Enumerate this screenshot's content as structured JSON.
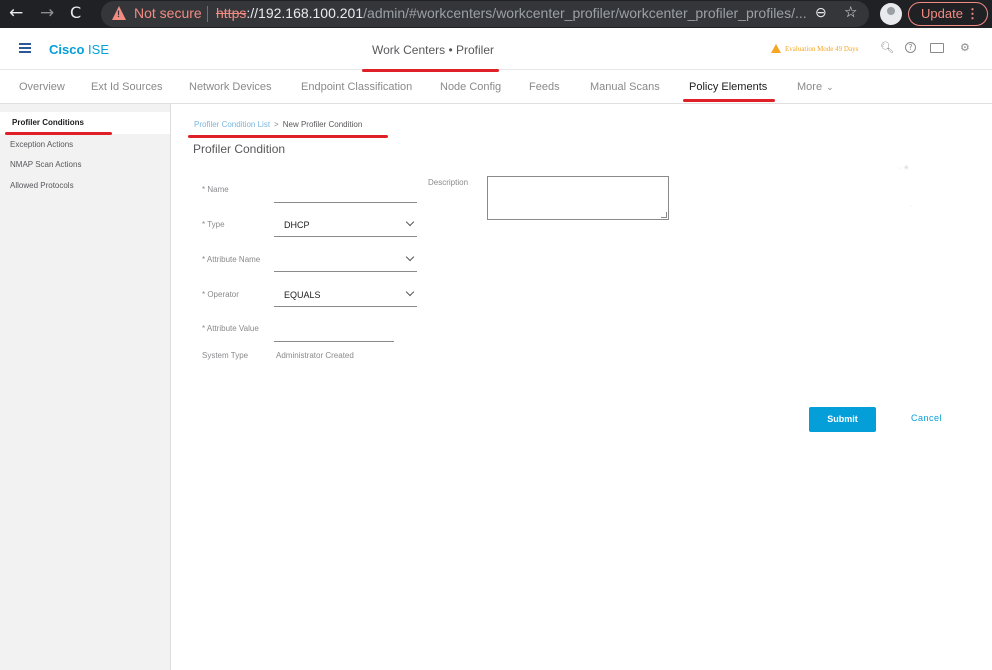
{
  "browser": {
    "back_icon": "←",
    "forward_icon": "→",
    "reload_icon": "C",
    "not_secure": "Not secure",
    "url_scheme": "https",
    "url_host": "://192.168.100.201",
    "url_path": "/admin/#workcenters/workcenter_profiler/workcenter_profiler_profiles/...",
    "zoom_icon": "⊖",
    "star_icon": "☆",
    "update_label": "Update",
    "update_menu": "⋮"
  },
  "header": {
    "brand_company": "Cisco",
    "brand_product": "ISE",
    "page_title": "Work Centers • Profiler",
    "eval_text": "Evaluation Mode 49 Days",
    "search_icon": "🔍︎",
    "help_icon": "?",
    "gear_icon": "⚙"
  },
  "tabs": [
    {
      "label": "Overview"
    },
    {
      "label": "Ext Id Sources"
    },
    {
      "label": "Network Devices"
    },
    {
      "label": "Endpoint Classification"
    },
    {
      "label": "Node Config"
    },
    {
      "label": "Feeds"
    },
    {
      "label": "Manual Scans"
    },
    {
      "label": "Policy Elements"
    },
    {
      "label": "More"
    }
  ],
  "more_caret": "⌄",
  "sidebar": {
    "items": [
      {
        "label": "Profiler Conditions"
      },
      {
        "label": "Exception Actions"
      },
      {
        "label": "NMAP Scan Actions"
      },
      {
        "label": "Allowed Protocols"
      }
    ]
  },
  "main": {
    "breadcrumb_link": "Profiler Condition List",
    "breadcrumb_sep": ">",
    "breadcrumb_current": "New Profiler Condition",
    "title": "Profiler Condition",
    "name_label": "* Name",
    "description_label": "Description",
    "type_label": "* Type",
    "type_value": "DHCP",
    "attribute_name_label": "* Attribute Name",
    "operator_label": "* Operator",
    "operator_value": "EQUALS",
    "attribute_value_label": "* Attribute Value",
    "system_type_label": "System Type",
    "system_type_value": "Administrator Created",
    "submit_label": "Submit",
    "cancel_label": "Cancel"
  },
  "colors": {
    "accent": "#049fd9",
    "annotation": "#e02027",
    "warning": "#f5a623"
  }
}
